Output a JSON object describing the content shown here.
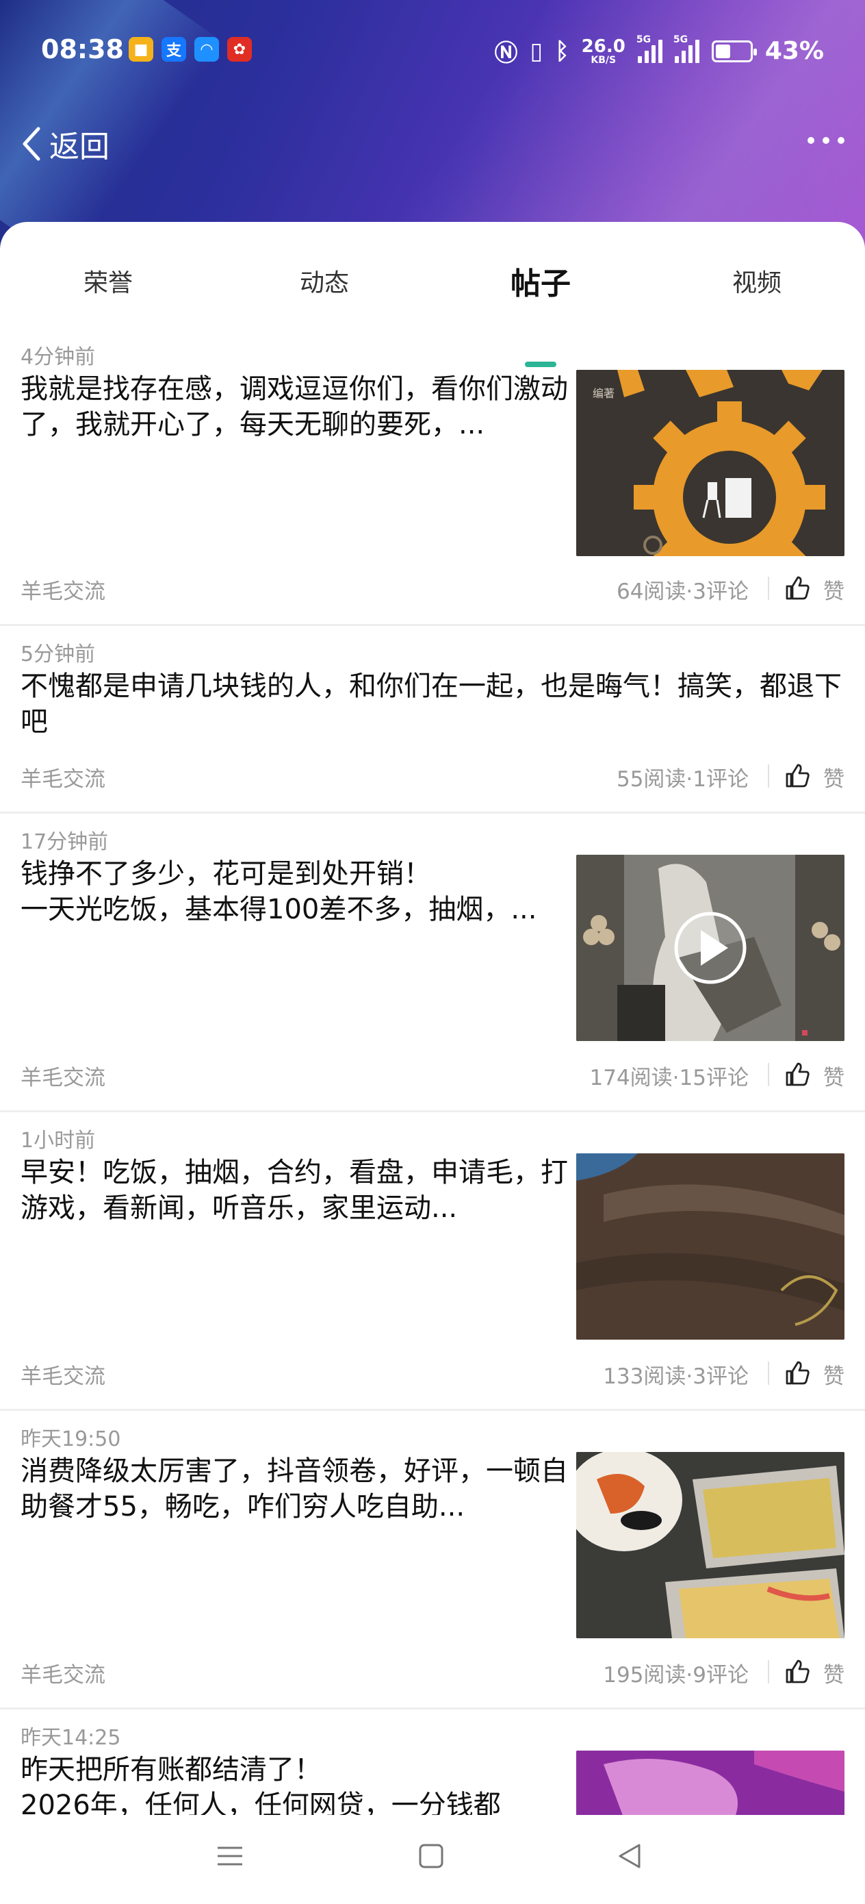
{
  "status_bar": {
    "time": "08:38",
    "app_icons": [
      {
        "name": "notes-app-icon",
        "glyph": "■",
        "color": "#f5b21a"
      },
      {
        "name": "alipay-icon",
        "glyph": "支",
        "color": "#1677ff"
      },
      {
        "name": "browser-app-icon",
        "glyph": "◠",
        "color": "#1e90ff"
      },
      {
        "name": "pinduoduo-icon",
        "glyph": "✿",
        "color": "#e02e24"
      }
    ],
    "network_speed": "26.0",
    "network_speed_unit": "KB/S",
    "signal_label_1": "5G",
    "signal_label_2": "5G",
    "battery": "43%",
    "battery_level": 0.43
  },
  "nav": {
    "back_label": "返回"
  },
  "tabs": [
    {
      "label": "荣誉"
    },
    {
      "label": "动态"
    },
    {
      "label": "帖子",
      "active": true
    },
    {
      "label": "视频"
    }
  ],
  "posts": [
    {
      "time": "4分钟前",
      "text": "我就是找存在感，调戏逗逗你们，看你们激动了，我就开心了，每天无聊的要死，...",
      "group": "羊毛交流",
      "stats": "64阅读·3评论",
      "like_label": "赞",
      "has_image": true
    },
    {
      "time": "5分钟前",
      "text": "不愧都是申请几块钱的人，和你们在一起，也是晦气！搞笑，都退下吧",
      "group": "羊毛交流",
      "stats": "55阅读·1评论",
      "like_label": "赞",
      "has_image": false
    },
    {
      "time": "17分钟前",
      "text": "钱挣不了多少，花可是到处开销！\n一天光吃饭，基本得100差不多，抽烟，...",
      "group": "羊毛交流",
      "stats": "174阅读·15评论",
      "like_label": "赞",
      "has_image": true,
      "video": true
    },
    {
      "time": "1小时前",
      "text": "早安！吃饭，抽烟，合约，看盘，申请毛，打游戏，看新闻，听音乐，家里运动...",
      "group": "羊毛交流",
      "stats": "133阅读·3评论",
      "like_label": "赞",
      "has_image": true
    },
    {
      "time": "昨天19:50",
      "text": "消费降级太厉害了，抖音领卷，好评，一顿自助餐才55，畅吃，咋们穷人吃自助...",
      "group": "羊毛交流",
      "stats": "195阅读·9评论",
      "like_label": "赞",
      "has_image": true
    },
    {
      "time": "昨天14:25",
      "text": "昨天把所有账都结清了！\n2026年，任何人，任何网贷，一分钱都",
      "has_image": true
    }
  ]
}
